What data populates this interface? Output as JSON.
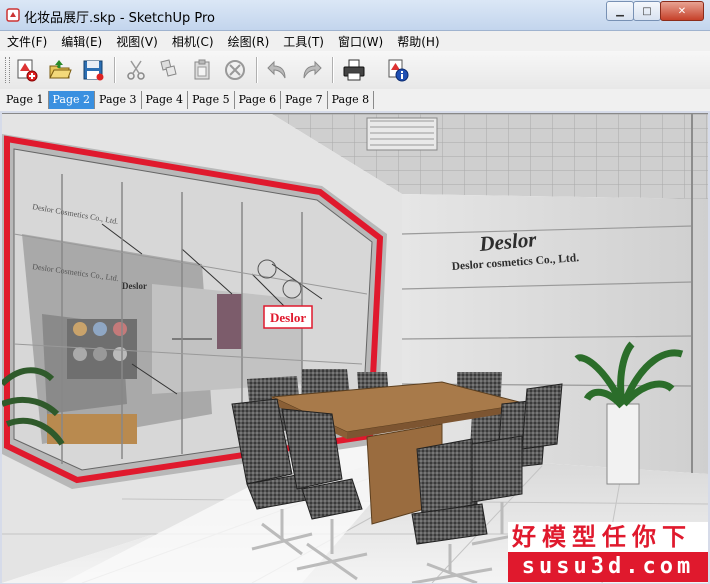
{
  "window": {
    "title": "化妆品展厅.skp - SketchUp Pro"
  },
  "menu": [
    {
      "label": "文件(F)",
      "key": "file"
    },
    {
      "label": "编辑(E)",
      "key": "edit"
    },
    {
      "label": "视图(V)",
      "key": "view"
    },
    {
      "label": "相机(C)",
      "key": "camera"
    },
    {
      "label": "绘图(R)",
      "key": "draw"
    },
    {
      "label": "工具(T)",
      "key": "tools"
    },
    {
      "label": "窗口(W)",
      "key": "window"
    },
    {
      "label": "帮助(H)",
      "key": "help"
    }
  ],
  "toolbar_icons": [
    "new-icon",
    "open-icon",
    "save-icon",
    "cut-icon",
    "copy-icon",
    "paste-icon",
    "erase-icon",
    "undo-icon",
    "redo-icon",
    "print-icon",
    "model-info-icon"
  ],
  "tabs": [
    {
      "label": "Page 1",
      "active": false
    },
    {
      "label": "Page 2",
      "active": true
    },
    {
      "label": "Page 3",
      "active": false
    },
    {
      "label": "Page 4",
      "active": false
    },
    {
      "label": "Page 5",
      "active": false
    },
    {
      "label": "Page 6",
      "active": false
    },
    {
      "label": "Page 7",
      "active": false
    },
    {
      "label": "Page 8",
      "active": false
    }
  ],
  "scene": {
    "brand": "Deslor",
    "company": "Deslor cosmetics Co., Ltd.",
    "window_sign": "Deslor"
  },
  "watermark": {
    "line1": "好模型任你下",
    "line2": "susu3d.com"
  },
  "colors": {
    "accent": "#e0192d",
    "tab_active": "#3a90e0"
  }
}
